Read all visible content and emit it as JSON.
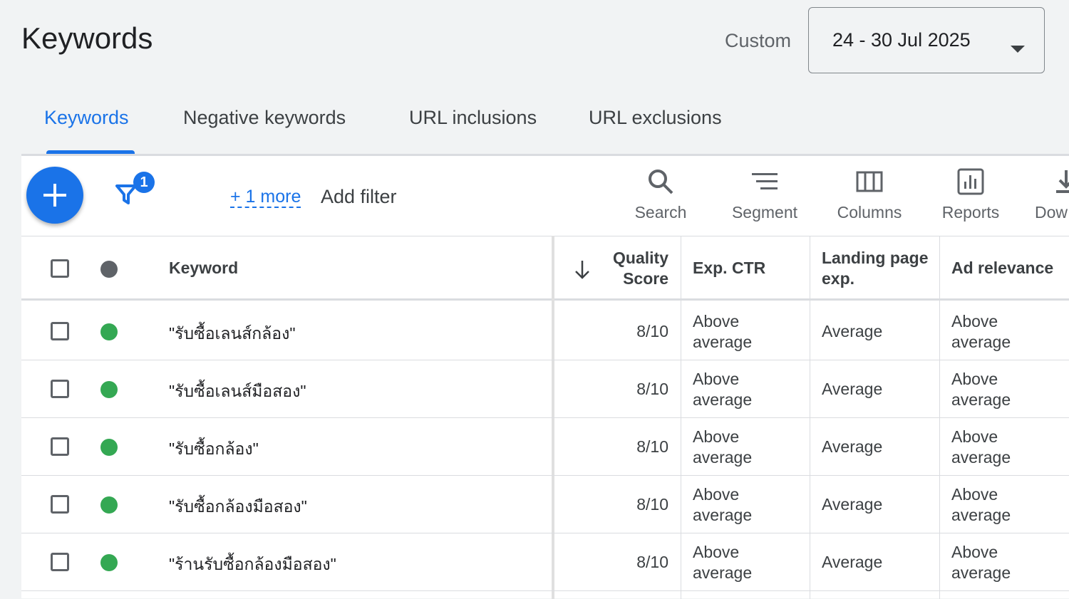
{
  "page": {
    "title": "Keywords"
  },
  "date_range": {
    "label": "Custom",
    "value": "24 - 30 Jul 2025"
  },
  "tabs": [
    {
      "label": "Keywords",
      "active": true
    },
    {
      "label": "Negative keywords",
      "active": false
    },
    {
      "label": "URL inclusions",
      "active": false
    },
    {
      "label": "URL exclusions",
      "active": false
    }
  ],
  "filter_bar": {
    "filter_count": "1",
    "more_link": "+ 1 more",
    "add_filter": "Add filter"
  },
  "toolbar": {
    "search": "Search",
    "segment": "Segment",
    "columns": "Columns",
    "reports": "Reports",
    "download": "Dow"
  },
  "table": {
    "columns": {
      "keyword": "Keyword",
      "quality_score_line1": "Quality",
      "quality_score_line2": "Score",
      "exp_ctr": "Exp. CTR",
      "landing_line1": "Landing page",
      "landing_line2": "exp.",
      "ad_relevance": "Ad relevance"
    },
    "rows": [
      {
        "keyword": "\"รับซื้อเลนส์กล้อง\"",
        "quality_score": "8/10",
        "exp_ctr_1": "Above",
        "exp_ctr_2": "average",
        "landing": "Average",
        "ad_rel_1": "Above",
        "ad_rel_2": "average"
      },
      {
        "keyword": "\"รับซื้อเลนส์มือสอง\"",
        "quality_score": "8/10",
        "exp_ctr_1": "Above",
        "exp_ctr_2": "average",
        "landing": "Average",
        "ad_rel_1": "Above",
        "ad_rel_2": "average"
      },
      {
        "keyword": "\"รับซื้อกล้อง\"",
        "quality_score": "8/10",
        "exp_ctr_1": "Above",
        "exp_ctr_2": "average",
        "landing": "Average",
        "ad_rel_1": "Above",
        "ad_rel_2": "average"
      },
      {
        "keyword": "\"รับซื้อกล้องมือสอง\"",
        "quality_score": "8/10",
        "exp_ctr_1": "Above",
        "exp_ctr_2": "average",
        "landing": "Average",
        "ad_rel_1": "Above",
        "ad_rel_2": "average"
      },
      {
        "keyword": "\"ร้านรับซื้อกล้องมือสอง\"",
        "quality_score": "8/10",
        "exp_ctr_1": "Above",
        "exp_ctr_2": "average",
        "landing": "Average",
        "ad_rel_1": "Above",
        "ad_rel_2": "average"
      }
    ]
  },
  "colors": {
    "accent": "#1a73e8",
    "status_enabled": "#34a853",
    "status_header": "#5f6368"
  }
}
